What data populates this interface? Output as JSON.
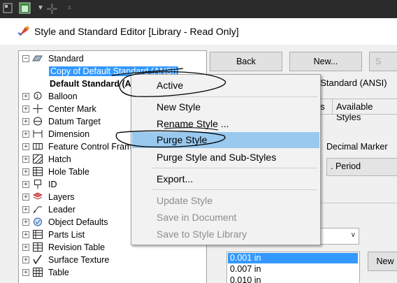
{
  "toolbar": {
    "icons": [
      "sheet-icon",
      "dropdown-arrow-icon",
      "move-icon",
      "overflow-icon"
    ]
  },
  "window": {
    "title": "Style and Standard Editor [Library - Read Only]"
  },
  "tree": {
    "items": [
      {
        "label": "Standard",
        "icon": "standard-icon",
        "expander": "−"
      },
      {
        "label": "Copy of Default Standard (ANSI)",
        "selected": true
      },
      {
        "label": "Default Standard (ANSI)",
        "bold": true
      },
      {
        "label": "Balloon",
        "icon": "balloon-icon",
        "expander": "+"
      },
      {
        "label": "Center Mark",
        "icon": "center-mark-icon",
        "expander": "+"
      },
      {
        "label": "Datum Target",
        "icon": "datum-target-icon",
        "expander": "+"
      },
      {
        "label": "Dimension",
        "icon": "dimension-icon",
        "expander": "+"
      },
      {
        "label": "Feature Control Frame",
        "icon": "feature-control-frame-icon",
        "expander": "+"
      },
      {
        "label": "Hatch",
        "icon": "hatch-icon",
        "expander": "+"
      },
      {
        "label": "Hole Table",
        "icon": "hole-table-icon",
        "expander": "+"
      },
      {
        "label": "ID",
        "icon": "id-icon",
        "expander": "+"
      },
      {
        "label": "Layers",
        "icon": "layers-icon",
        "expander": "+"
      },
      {
        "label": "Leader",
        "icon": "leader-icon",
        "expander": "+"
      },
      {
        "label": "Object Defaults",
        "icon": "object-defaults-icon",
        "expander": "+"
      },
      {
        "label": "Parts List",
        "icon": "parts-list-icon",
        "expander": "+"
      },
      {
        "label": "Revision Table",
        "icon": "revision-table-icon",
        "expander": "+"
      },
      {
        "label": "Surface Texture",
        "icon": "surface-texture-icon",
        "expander": "+"
      },
      {
        "label": "Table",
        "icon": "table-icon",
        "expander": "+"
      }
    ]
  },
  "buttons": {
    "back": "Back",
    "new": "New...",
    "new_small": "New"
  },
  "right": {
    "style_name": "t Standard (ANSI)",
    "tab_styles": "es",
    "tab_available": "Available Styles",
    "decimal_marker_label": "Decimal Marker",
    "decimal_marker_value": ". Period",
    "list_values": [
      "0.001 in",
      "0.007 in",
      "0.010 in"
    ]
  },
  "context_menu": {
    "items": [
      "Active",
      "New Style",
      "Rename Style ...",
      "Purge Style",
      "Purge Style and Sub-Styles",
      "Export...",
      "Update Style",
      "Save in Document",
      "Save to Style Library"
    ],
    "highlighted": "Purge Style",
    "highlight_color": "#99c9ef",
    "selection_color": "#3399ff"
  }
}
